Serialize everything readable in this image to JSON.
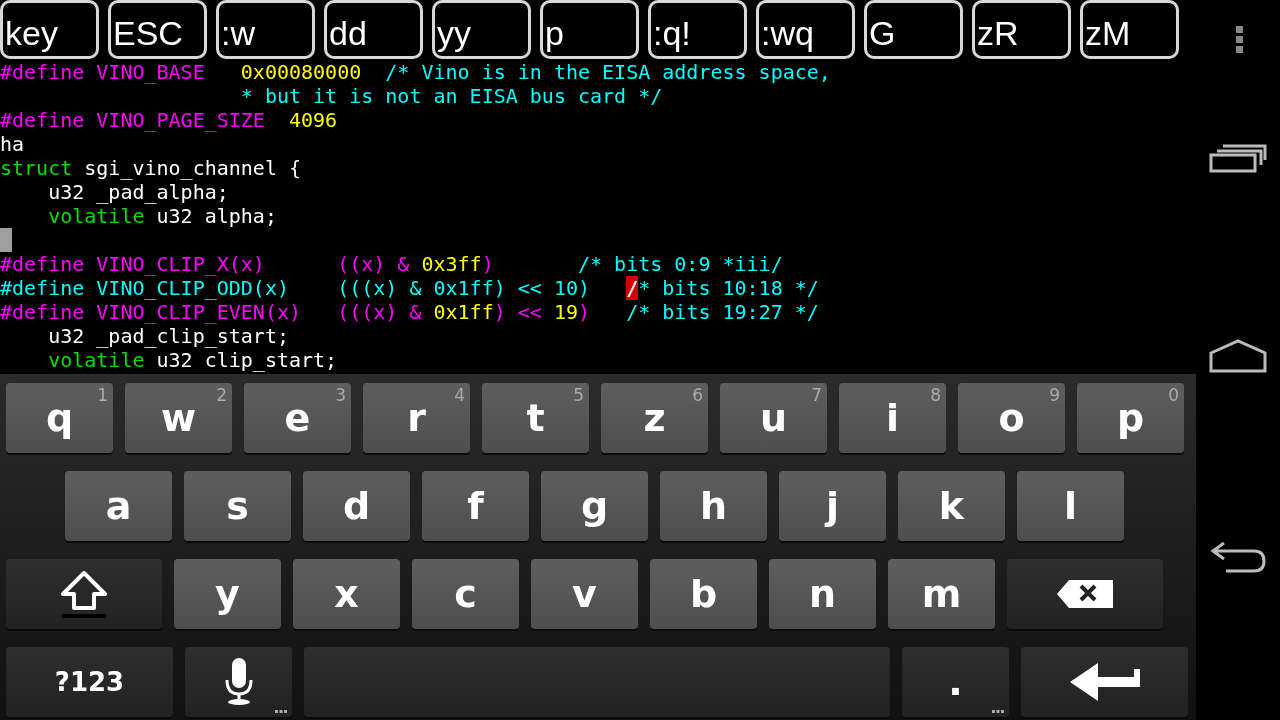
{
  "toolbar": {
    "keys": [
      "key",
      "ESC",
      ":w",
      "dd",
      "yy",
      "p",
      ":q!",
      ":wq",
      "G",
      "zR",
      "zM"
    ]
  },
  "editor": {
    "lines": [
      {
        "kind": "code",
        "segments": [
          {
            "text": "#define VINO_BASE   ",
            "color": "#ff00ff",
            "cursor": false
          },
          {
            "text": "0x00080000",
            "color": "#ffff00",
            "cursor": false
          },
          {
            "text": "  /* Vino is in the EISA address space,",
            "color": "#00ffff",
            "cursor": false
          }
        ]
      },
      {
        "kind": "code",
        "segments": [
          {
            "text": "                    * but it is not an EISA bus card */",
            "color": "#00ffff",
            "cursor": false
          }
        ]
      },
      {
        "kind": "code",
        "segments": [
          {
            "text": "#define VINO_PAGE_SIZE  ",
            "color": "#ff00ff",
            "cursor": false
          },
          {
            "text": "4096",
            "color": "#ffff00",
            "cursor": false
          }
        ]
      },
      {
        "kind": "code",
        "segments": [
          {
            "text": "ha",
            "color": "#ffffff",
            "cursor": false
          }
        ]
      },
      {
        "kind": "code",
        "segments": [
          {
            "text": "struct",
            "color": "#00e000",
            "cursor": false
          },
          {
            "text": " sgi_vino_channel {",
            "color": "#ffffff",
            "cursor": false
          }
        ]
      },
      {
        "kind": "code",
        "segments": [
          {
            "text": "    u32 _pad_alpha;",
            "color": "#ffffff",
            "cursor": false
          }
        ]
      },
      {
        "kind": "code",
        "segments": [
          {
            "text": "    volatile",
            "color": "#00e000",
            "cursor": false
          },
          {
            "text": " u32 alpha;",
            "color": "#ffffff",
            "cursor": false
          }
        ]
      },
      {
        "kind": "cursor"
      },
      {
        "kind": "code",
        "segments": [
          {
            "text": "#define VINO_CLIP_X(x)      ((x) & ",
            "color": "#ff00ff",
            "cursor": false
          },
          {
            "text": "0x3ff",
            "color": "#ffff00",
            "cursor": false
          },
          {
            "text": ")",
            "color": "#ff00ff",
            "cursor": false
          },
          {
            "text": "       /* bits 0:9 *iii/",
            "color": "#00ffff",
            "cursor": false
          }
        ]
      },
      {
        "kind": "code",
        "segments": [
          {
            "text": "#define VINO_CLIP_ODD(x)    (((x) & 0x1ff) << 10)   ",
            "color": "#00ffff",
            "cursor": false
          },
          {
            "text": "/",
            "color": "#d00000",
            "cursor": true
          },
          {
            "text": "* bits 10:18 */",
            "color": "#00ffff",
            "cursor": false
          }
        ]
      },
      {
        "kind": "code",
        "segments": [
          {
            "text": "#define VINO_CLIP_EVEN(x)   (((x) & ",
            "color": "#ff00ff",
            "cursor": false
          },
          {
            "text": "0x1ff",
            "color": "#ffff00",
            "cursor": false
          },
          {
            "text": ") << ",
            "color": "#ff00ff",
            "cursor": false
          },
          {
            "text": "19",
            "color": "#ffff00",
            "cursor": false
          },
          {
            "text": ")",
            "color": "#ff00ff",
            "cursor": false
          },
          {
            "text": "   /* bits 19:27 */",
            "color": "#00ffff",
            "cursor": false
          }
        ]
      },
      {
        "kind": "code",
        "segments": [
          {
            "text": "    u32 _pad_clip_start;",
            "color": "#ffffff",
            "cursor": false
          }
        ]
      },
      {
        "kind": "code",
        "segments": [
          {
            "text": "    volatile",
            "color": "#00e000",
            "cursor": false
          },
          {
            "text": " u32 clip_start;",
            "color": "#ffffff",
            "cursor": false
          }
        ]
      }
    ]
  },
  "keyboard": {
    "rows": [
      {
        "keys": [
          {
            "kind": "letter",
            "label": "q",
            "hint": "1"
          },
          {
            "kind": "letter",
            "label": "w",
            "hint": "2"
          },
          {
            "kind": "letter",
            "label": "e",
            "hint": "3"
          },
          {
            "kind": "letter",
            "label": "r",
            "hint": "4"
          },
          {
            "kind": "letter",
            "label": "t",
            "hint": "5"
          },
          {
            "kind": "letter",
            "label": "z",
            "hint": "6"
          },
          {
            "kind": "letter",
            "label": "u",
            "hint": "7"
          },
          {
            "kind": "letter",
            "label": "i",
            "hint": "8"
          },
          {
            "kind": "letter",
            "label": "o",
            "hint": "9"
          },
          {
            "kind": "letter",
            "label": "p",
            "hint": "0"
          }
        ]
      },
      {
        "keys": [
          {
            "kind": "letter",
            "label": "a"
          },
          {
            "kind": "letter",
            "label": "s"
          },
          {
            "kind": "letter",
            "label": "d"
          },
          {
            "kind": "letter",
            "label": "f"
          },
          {
            "kind": "letter",
            "label": "g"
          },
          {
            "kind": "letter",
            "label": "h"
          },
          {
            "kind": "letter",
            "label": "j"
          },
          {
            "kind": "letter",
            "label": "k"
          },
          {
            "kind": "letter",
            "label": "l"
          }
        ]
      },
      {
        "keys": [
          {
            "kind": "shift"
          },
          {
            "kind": "letter",
            "label": "y"
          },
          {
            "kind": "letter",
            "label": "x"
          },
          {
            "kind": "letter",
            "label": "c"
          },
          {
            "kind": "letter",
            "label": "v"
          },
          {
            "kind": "letter",
            "label": "b"
          },
          {
            "kind": "letter",
            "label": "n"
          },
          {
            "kind": "letter",
            "label": "m"
          },
          {
            "kind": "backspace"
          }
        ]
      },
      {
        "keys": [
          {
            "kind": "symbols",
            "label": "?123"
          },
          {
            "kind": "mic"
          },
          {
            "kind": "space"
          },
          {
            "kind": "period",
            "label": "."
          },
          {
            "kind": "enter"
          }
        ]
      }
    ]
  }
}
